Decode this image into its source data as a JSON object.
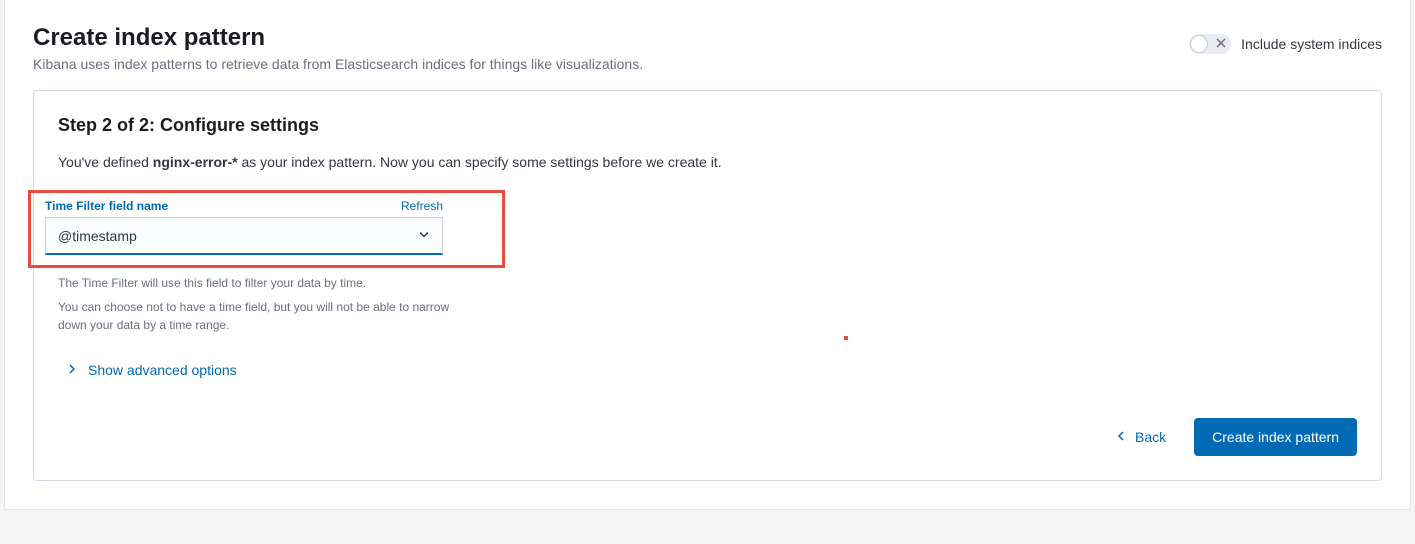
{
  "header": {
    "title": "Create index pattern",
    "subtitle": "Kibana uses index patterns to retrieve data from Elasticsearch indices for things like visualizations.",
    "toggle_label": "Include system indices"
  },
  "step": {
    "title": "Step 2 of 2: Configure settings",
    "desc_pre": "You've defined ",
    "pattern": "nginx-error-*",
    "desc_post": " as your index pattern. Now you can specify some settings before we create it."
  },
  "time_filter": {
    "label": "Time Filter field name",
    "refresh": "Refresh",
    "value": "@timestamp",
    "help1": "The Time Filter will use this field to filter your data by time.",
    "help2": "You can choose not to have a time field, but you will not be able to narrow down your data by a time range."
  },
  "advanced": {
    "label": "Show advanced options"
  },
  "footer": {
    "back": "Back",
    "create": "Create index pattern"
  }
}
